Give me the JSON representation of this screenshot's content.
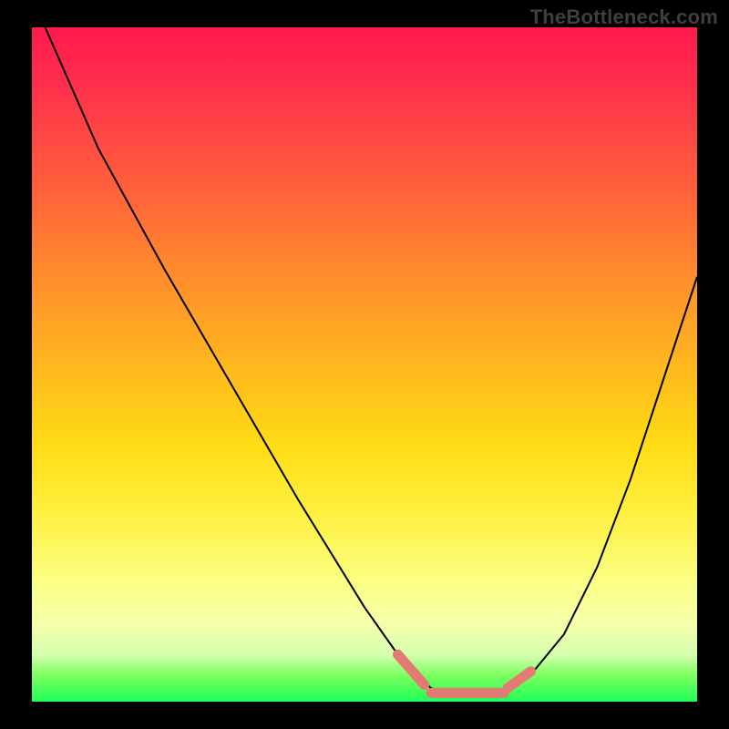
{
  "watermark": "TheBottleneck.com",
  "colors": {
    "background": "#000000",
    "watermark_text": "#3f3f3f",
    "curve": "#000000",
    "valley_marker": "#e37b74",
    "gradient_top": "#ff1a4d",
    "gradient_bottom": "#1dff55"
  },
  "chart_data": {
    "type": "line",
    "title": "",
    "xlabel": "",
    "ylabel": "",
    "xlim": [
      0,
      100
    ],
    "ylim": [
      0,
      100
    ],
    "grid": false,
    "legend": false,
    "series": [
      {
        "name": "bottleneck-curve",
        "x": [
          2,
          10,
          20,
          30,
          40,
          50,
          55,
          58,
          60,
          64,
          68,
          72,
          75,
          80,
          85,
          90,
          95,
          100
        ],
        "values": [
          100,
          82,
          64,
          47,
          30,
          14,
          7,
          4,
          2,
          1,
          1,
          2,
          4,
          10,
          20,
          33,
          48,
          63
        ]
      }
    ],
    "valley_marker": {
      "left_segment": {
        "x": [
          55,
          59
        ],
        "y": [
          7,
          2.5
        ]
      },
      "flat_segment": {
        "x": [
          60,
          71
        ],
        "y": [
          1.3,
          1.3
        ]
      },
      "right_segment": {
        "x": [
          71.5,
          75
        ],
        "y": [
          2,
          4.5
        ]
      }
    },
    "note": "x and y are in percent of plot area; y=0 is bottom (green), y=100 is top (red)."
  }
}
